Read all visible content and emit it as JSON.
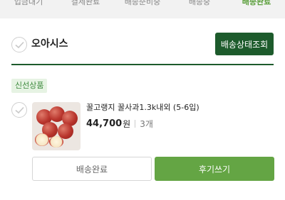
{
  "tabs": [
    {
      "label": "입금대기"
    },
    {
      "label": "결제완료"
    },
    {
      "label": "배송준비중"
    },
    {
      "label": "배송중"
    },
    {
      "label": "배송완료"
    }
  ],
  "active_tab": 4,
  "seller": {
    "name": "오아시스",
    "status_button": "배송상태조회"
  },
  "item": {
    "badge": "신선상품",
    "name": "꿀고랭지 꿀사과1.3k내외 (5-6입)",
    "price": "44,700",
    "currency": "원",
    "quantity": "3개",
    "thumbnail": "apples-image"
  },
  "actions": {
    "done_label": "배송완료",
    "review_label": "후기쓰기"
  },
  "colors": {
    "accent_dark": "#1d5b2c",
    "accent": "#64a544",
    "badge_bg": "#e6f3e3",
    "badge_text": "#3f8b3f"
  },
  "icons": {
    "check": "check-icon"
  }
}
